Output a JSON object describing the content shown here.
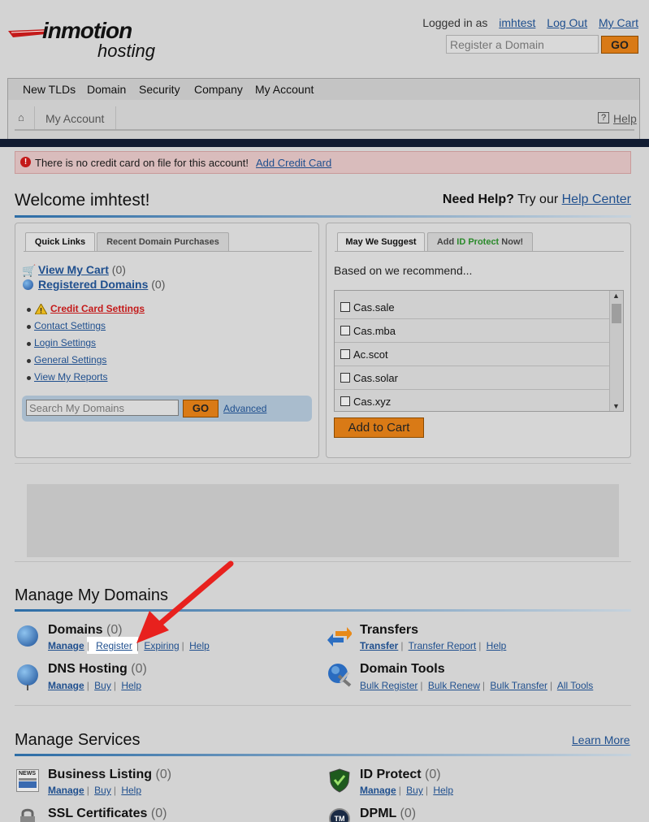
{
  "header": {
    "logo_text": "inmotion",
    "logo_sub": "hosting",
    "logged_in_label": "Logged in as",
    "username": "imhtest",
    "logout": "Log Out",
    "cart": "My Cart",
    "domain_search_placeholder": "Register a Domain",
    "go": "GO"
  },
  "nav": [
    "New TLDs",
    "Domain",
    "Security",
    "Company",
    "My Account"
  ],
  "breadcrumb": {
    "current": "My Account",
    "help": "Help"
  },
  "alert": {
    "text": "There is no credit card on file for this account!",
    "link": "Add Credit Card"
  },
  "welcome": "Welcome imhtest!",
  "need_help": {
    "bold": "Need Help?",
    "text": "Try our",
    "link": "Help Center"
  },
  "quick_panel": {
    "tabs": [
      "Quick Links",
      "Recent Domain Purchases"
    ],
    "cart": {
      "label": "View My Cart",
      "count": "(0)"
    },
    "registered": {
      "label": "Registered Domains",
      "count": "(0)"
    },
    "settings": [
      "Credit Card Settings",
      "Contact Settings",
      "Login Settings",
      "General Settings",
      "View My Reports"
    ],
    "search_placeholder": "Search My Domains",
    "go": "GO",
    "advanced": "Advanced"
  },
  "suggest_panel": {
    "tabs": [
      "May We Suggest",
      "Add",
      "ID Protect",
      "Now!"
    ],
    "intro": "Based on we recommend...",
    "domains": [
      "Cas.sale",
      "Cas.mba",
      "Ac.scot",
      "Cas.solar",
      "Cas.xyz"
    ],
    "add_to_cart": "Add to Cart"
  },
  "manage_domains": {
    "title": "Manage My Domains",
    "domains": {
      "name": "Domains",
      "count": "(0)",
      "links": [
        "Manage",
        "Register",
        "Expiring",
        "Help"
      ]
    },
    "transfers": {
      "name": "Transfers",
      "links": [
        "Transfer",
        "Transfer Report",
        "Help"
      ]
    },
    "dns": {
      "name": "DNS Hosting",
      "count": "(0)",
      "links": [
        "Manage",
        "Buy",
        "Help"
      ]
    },
    "tools": {
      "name": "Domain Tools",
      "links": [
        "Bulk Register",
        "Bulk Renew",
        "Bulk Transfer",
        "All Tools"
      ]
    }
  },
  "manage_services": {
    "title": "Manage Services",
    "learn_more": "Learn More",
    "business": {
      "name": "Business Listing",
      "count": "(0)",
      "links": [
        "Manage",
        "Buy",
        "Help"
      ],
      "icon_text": "NEWS"
    },
    "idprotect": {
      "name": "ID Protect",
      "count": "(0)",
      "links": [
        "Manage",
        "Buy",
        "Help"
      ]
    },
    "ssl": {
      "name": "SSL Certificates",
      "count": "(0)"
    },
    "dpml": {
      "name": "DPML",
      "count": "(0)",
      "icon_text": "TM"
    }
  },
  "colors": {
    "accent": "#1f4f8e",
    "go_button": "#d97a16",
    "alert_bg": "#d9bcbc",
    "arrow": "#e8211e"
  }
}
